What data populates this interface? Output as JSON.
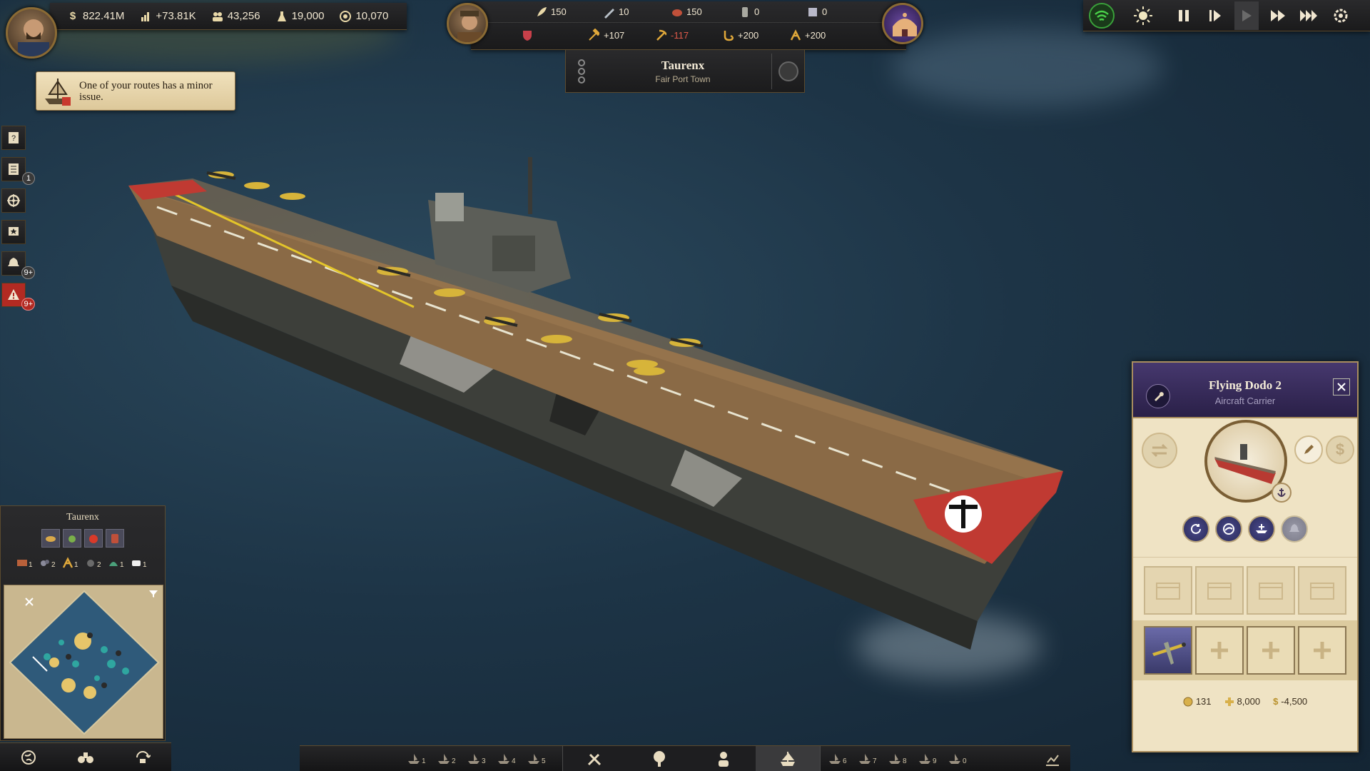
{
  "top_left": {
    "money": "822.41M",
    "income": "+73.81K",
    "population": "43,256",
    "influence": "19,000",
    "research": "10,070"
  },
  "top_center": {
    "goods": [
      {
        "icon": "feather-icon",
        "value": "150"
      },
      {
        "icon": "quill-icon",
        "value": "10"
      },
      {
        "icon": "meat-icon",
        "value": "150"
      },
      {
        "icon": "bottle-icon",
        "value": "0"
      },
      {
        "icon": "tablet-icon",
        "value": "0"
      }
    ],
    "stats": [
      {
        "icon": "shield-icon",
        "value": ""
      },
      {
        "icon": "hammer-icon",
        "value": "+107"
      },
      {
        "icon": "pickaxe-icon",
        "value": "-117",
        "negative": true
      },
      {
        "icon": "hook-icon",
        "value": "+200"
      },
      {
        "icon": "tool-icon",
        "value": "+200"
      }
    ],
    "town_name": "Taurenx",
    "town_subtitle": "Fair Port Town"
  },
  "notification": {
    "text": "One of your routes has a minor issue."
  },
  "left_sidebar": [
    {
      "icon": "question-book-icon",
      "badge": ""
    },
    {
      "icon": "ledger-icon",
      "badge": "1"
    },
    {
      "icon": "ship-wheel-icon",
      "badge": ""
    },
    {
      "icon": "star-flag-icon",
      "badge": ""
    },
    {
      "icon": "bell-icon",
      "badge": "9+"
    },
    {
      "icon": "warning-icon",
      "badge": "9+",
      "alert": true
    }
  ],
  "minimap": {
    "title": "Taurenx",
    "goods_row1": [
      "bread-icon",
      "vegetable-icon",
      "apple-icon",
      "jar-icon"
    ],
    "goods_row2": [
      {
        "icon": "brick-icon",
        "count": "1"
      },
      {
        "icon": "ore-icon",
        "count": "2"
      },
      {
        "icon": "tool-icon",
        "count": "1"
      },
      {
        "icon": "coal-icon",
        "count": "2"
      },
      {
        "icon": "fabric-icon",
        "count": "1"
      },
      {
        "icon": "soap-icon",
        "count": "1"
      }
    ]
  },
  "ship_panel": {
    "name": "Flying Dodo 2",
    "type": "Aircraft Carrier",
    "upkeep_influence": "131",
    "attack": "8,000",
    "upkeep_money": "-4,500"
  },
  "bottom_bar": {
    "ship_groups_left": [
      "1",
      "2",
      "3",
      "4",
      "5"
    ],
    "ship_groups_right": [
      "6",
      "7",
      "8",
      "9",
      "0"
    ],
    "modes": [
      "build-tools-icon",
      "tree-icon",
      "person-icon",
      "ship-icon"
    ]
  },
  "colors": {
    "panel_header": "#3a2e5a",
    "panel_bg": "#efe3c4",
    "alert_red": "#b22a22",
    "sea": "#1d3446"
  }
}
